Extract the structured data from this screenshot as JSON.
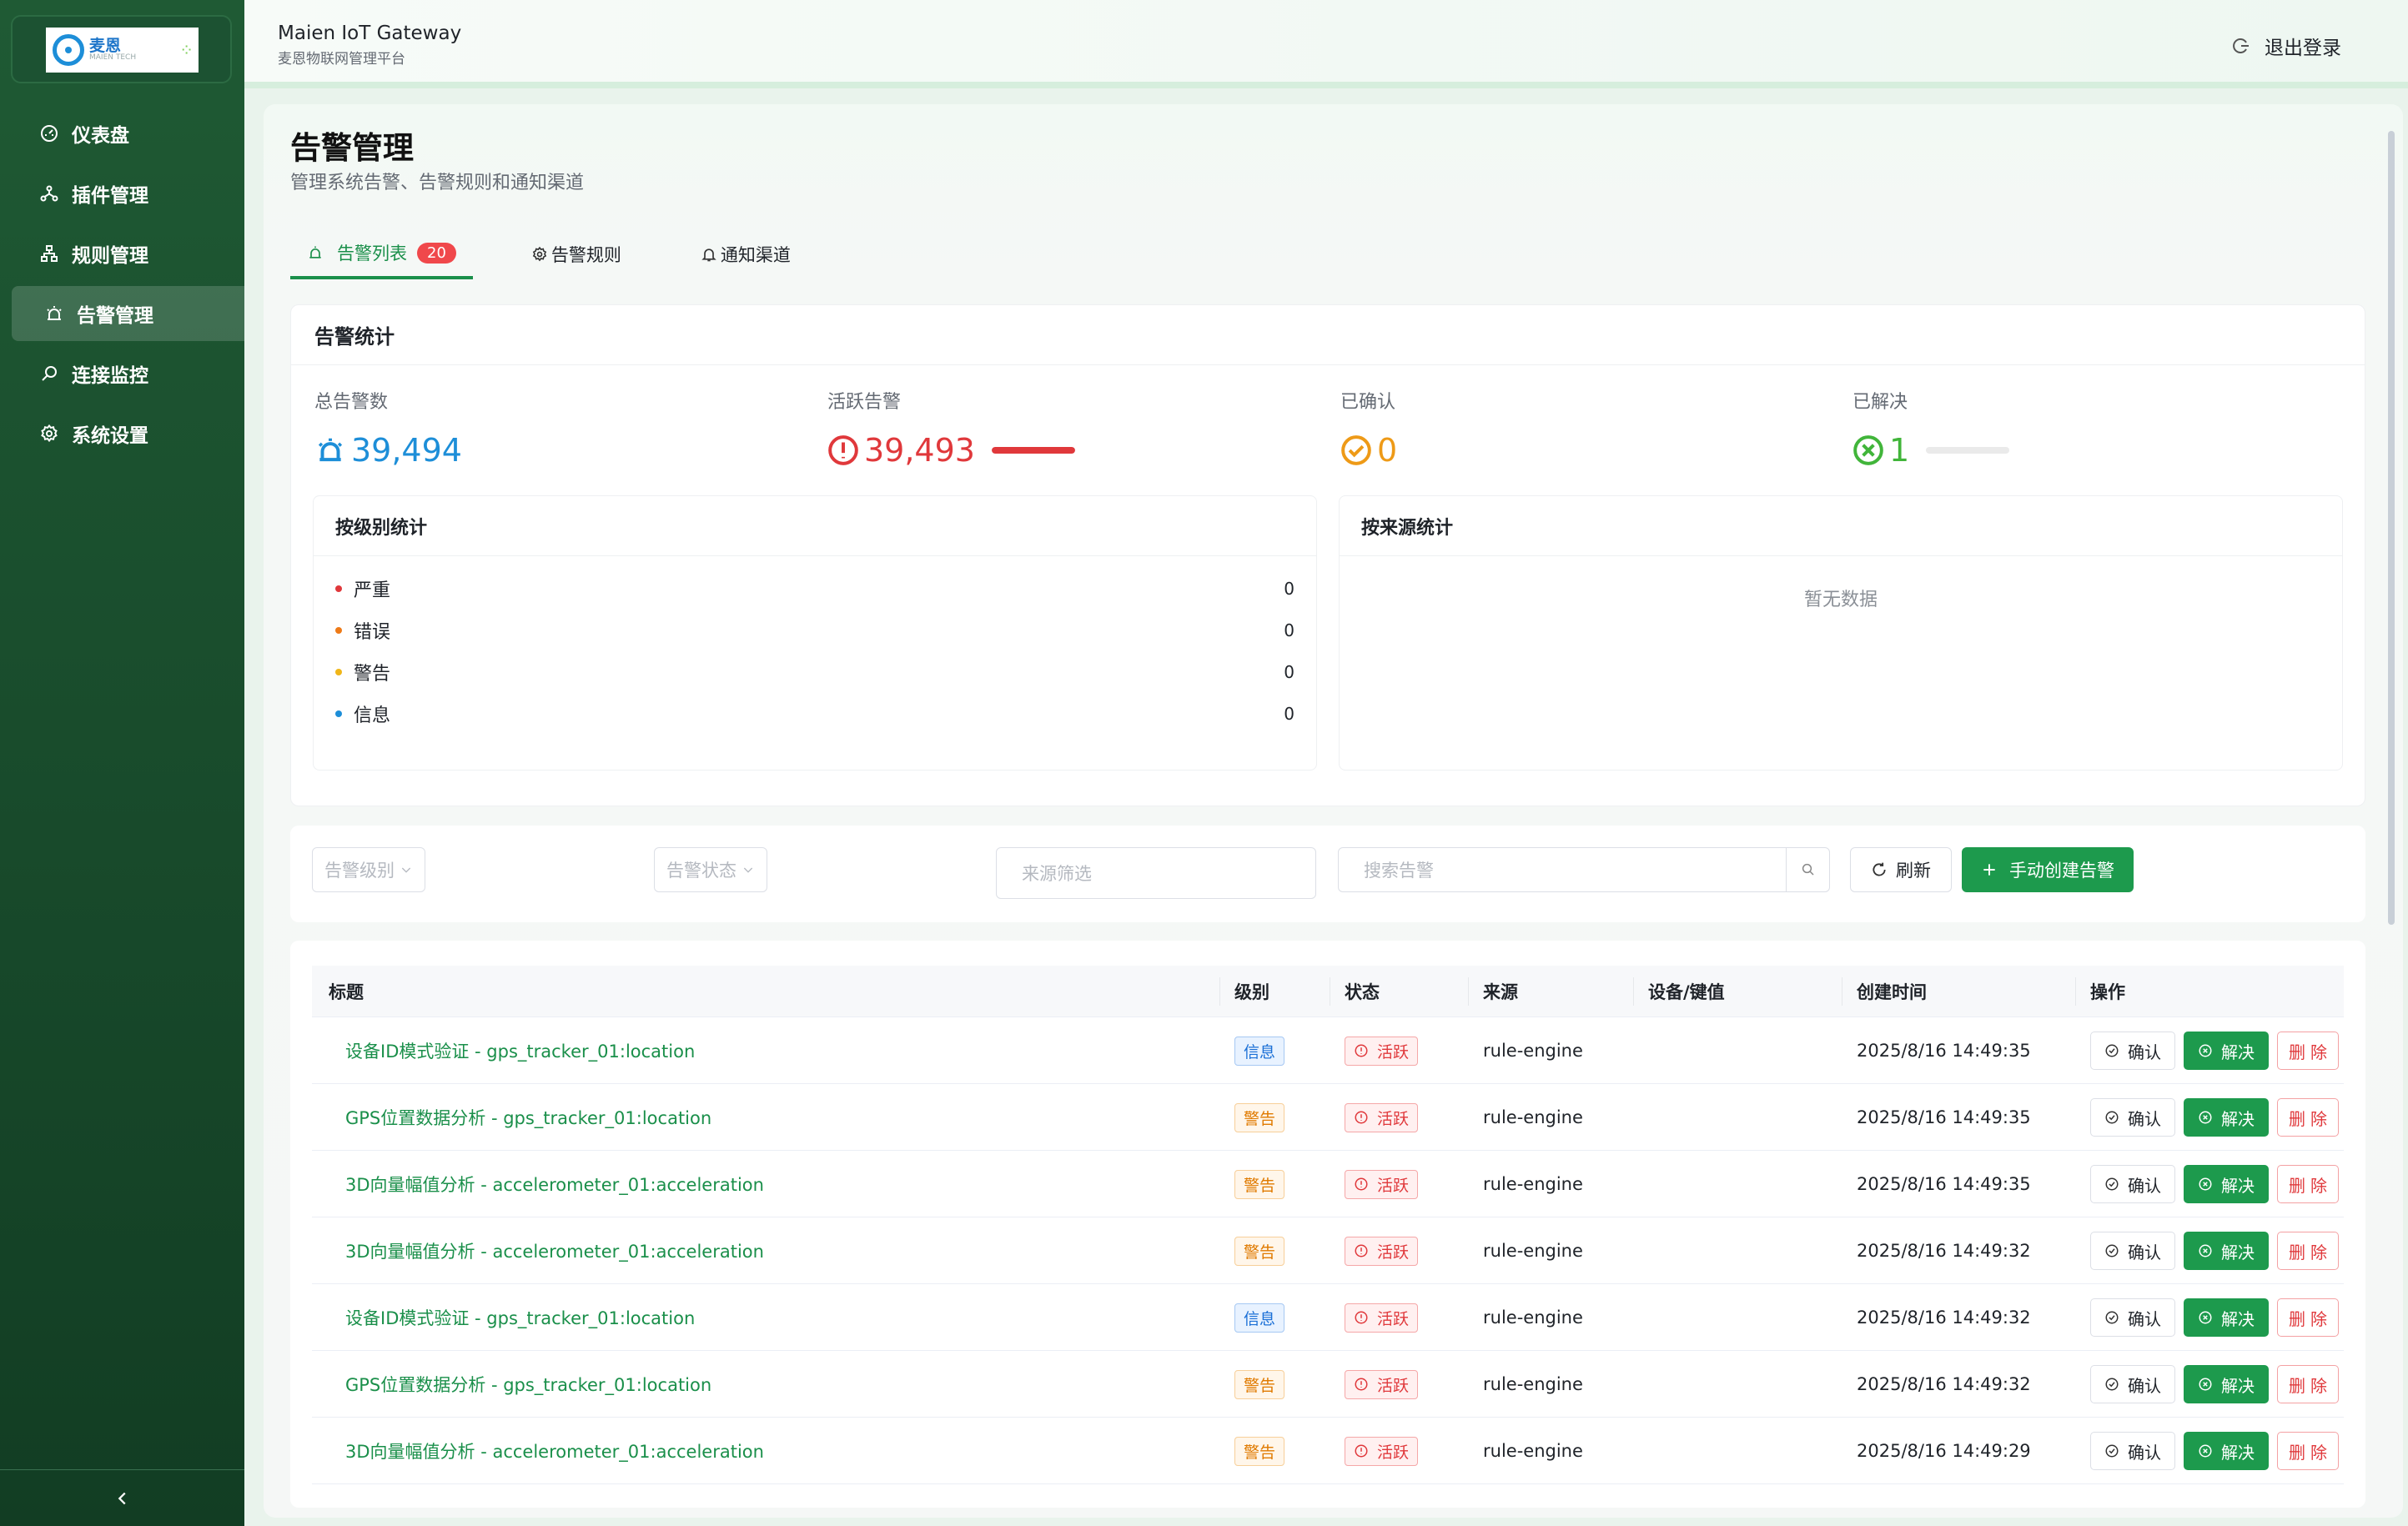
{
  "logo": {
    "text_cn": "麦恩",
    "text_en": "MAIEN TECH"
  },
  "sidebar": {
    "items": [
      {
        "label": "仪表盘",
        "icon": "dashboard-icon"
      },
      {
        "label": "插件管理",
        "icon": "plugin-icon"
      },
      {
        "label": "规则管理",
        "icon": "rules-icon"
      },
      {
        "label": "告警管理",
        "icon": "alarm-icon",
        "active": true
      },
      {
        "label": "连接监控",
        "icon": "monitor-icon"
      },
      {
        "label": "系统设置",
        "icon": "gear-icon"
      }
    ],
    "collapse_icon": "chevron-left-icon"
  },
  "header": {
    "title_en": "Maien IoT Gateway",
    "title_cn": "麦恩物联网管理平台",
    "logout": "退出登录"
  },
  "page": {
    "title": "告警管理",
    "subtitle": "管理系统告警、告警规则和通知渠道"
  },
  "tabs": {
    "list": "告警列表",
    "list_badge": "20",
    "rules": "告警规则",
    "channels": "通知渠道"
  },
  "stats": {
    "title": "告警统计",
    "total_label": "总告警数",
    "total": "39,494",
    "active_label": "活跃告警",
    "active": "39,493",
    "active_fraction": 0.99997,
    "ack_label": "已确认",
    "ack": "0",
    "resolved_label": "已解决",
    "resolved": "1",
    "resolved_fraction": 3e-05,
    "colors": {
      "total": "#1d8ed8",
      "active": "#e0383b",
      "ack": "#ee9a17",
      "resolved": "#41b53a"
    }
  },
  "by_level": {
    "title": "按级别统计",
    "rows": [
      {
        "label": "严重",
        "count": "0",
        "color": "#e0383b"
      },
      {
        "label": "错误",
        "count": "0",
        "color": "#ee7a17"
      },
      {
        "label": "警告",
        "count": "0",
        "color": "#f0b619"
      },
      {
        "label": "信息",
        "count": "0",
        "color": "#1d8ed8"
      }
    ]
  },
  "by_source": {
    "title": "按来源统计",
    "empty": "暂无数据"
  },
  "filters": {
    "level_placeholder": "告警级别",
    "status_placeholder": "告警状态",
    "source_placeholder": "来源筛选",
    "search_placeholder": "搜索告警",
    "refresh": "刷新",
    "create": "手动创建告警"
  },
  "table": {
    "columns": [
      "标题",
      "级别",
      "状态",
      "来源",
      "设备/键值",
      "创建时间",
      "操作"
    ],
    "actions": {
      "confirm": "确认",
      "resolve": "解决",
      "delete": "删除"
    },
    "rows": [
      {
        "title": "设备ID模式验证 - gps_tracker_01:location",
        "level": "信息",
        "level_type": "info",
        "status": "活跃",
        "source": "rule-engine",
        "device": "",
        "time": "2025/8/16 14:49:35"
      },
      {
        "title": "GPS位置数据分析 - gps_tracker_01:location",
        "level": "警告",
        "level_type": "warn",
        "status": "活跃",
        "source": "rule-engine",
        "device": "",
        "time": "2025/8/16 14:49:35"
      },
      {
        "title": "3D向量幅值分析 - accelerometer_01:acceleration",
        "level": "警告",
        "level_type": "warn",
        "status": "活跃",
        "source": "rule-engine",
        "device": "",
        "time": "2025/8/16 14:49:35"
      },
      {
        "title": "3D向量幅值分析 - accelerometer_01:acceleration",
        "level": "警告",
        "level_type": "warn",
        "status": "活跃",
        "source": "rule-engine",
        "device": "",
        "time": "2025/8/16 14:49:32"
      },
      {
        "title": "设备ID模式验证 - gps_tracker_01:location",
        "level": "信息",
        "level_type": "info",
        "status": "活跃",
        "source": "rule-engine",
        "device": "",
        "time": "2025/8/16 14:49:32"
      },
      {
        "title": "GPS位置数据分析 - gps_tracker_01:location",
        "level": "警告",
        "level_type": "warn",
        "status": "活跃",
        "source": "rule-engine",
        "device": "",
        "time": "2025/8/16 14:49:32"
      },
      {
        "title": "3D向量幅值分析 - accelerometer_01:acceleration",
        "level": "警告",
        "level_type": "warn",
        "status": "活跃",
        "source": "rule-engine",
        "device": "",
        "time": "2025/8/16 14:49:29"
      }
    ]
  }
}
